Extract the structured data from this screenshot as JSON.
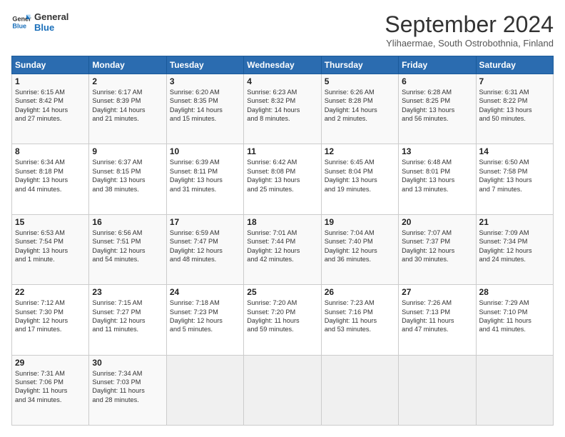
{
  "header": {
    "logo_line1": "General",
    "logo_line2": "Blue",
    "month": "September 2024",
    "location": "Ylihaermae, South Ostrobothnia, Finland"
  },
  "weekdays": [
    "Sunday",
    "Monday",
    "Tuesday",
    "Wednesday",
    "Thursday",
    "Friday",
    "Saturday"
  ],
  "weeks": [
    [
      {
        "day": "1",
        "info": "Sunrise: 6:15 AM\nSunset: 8:42 PM\nDaylight: 14 hours\nand 27 minutes."
      },
      {
        "day": "2",
        "info": "Sunrise: 6:17 AM\nSunset: 8:39 PM\nDaylight: 14 hours\nand 21 minutes."
      },
      {
        "day": "3",
        "info": "Sunrise: 6:20 AM\nSunset: 8:35 PM\nDaylight: 14 hours\nand 15 minutes."
      },
      {
        "day": "4",
        "info": "Sunrise: 6:23 AM\nSunset: 8:32 PM\nDaylight: 14 hours\nand 8 minutes."
      },
      {
        "day": "5",
        "info": "Sunrise: 6:26 AM\nSunset: 8:28 PM\nDaylight: 14 hours\nand 2 minutes."
      },
      {
        "day": "6",
        "info": "Sunrise: 6:28 AM\nSunset: 8:25 PM\nDaylight: 13 hours\nand 56 minutes."
      },
      {
        "day": "7",
        "info": "Sunrise: 6:31 AM\nSunset: 8:22 PM\nDaylight: 13 hours\nand 50 minutes."
      }
    ],
    [
      {
        "day": "8",
        "info": "Sunrise: 6:34 AM\nSunset: 8:18 PM\nDaylight: 13 hours\nand 44 minutes."
      },
      {
        "day": "9",
        "info": "Sunrise: 6:37 AM\nSunset: 8:15 PM\nDaylight: 13 hours\nand 38 minutes."
      },
      {
        "day": "10",
        "info": "Sunrise: 6:39 AM\nSunset: 8:11 PM\nDaylight: 13 hours\nand 31 minutes."
      },
      {
        "day": "11",
        "info": "Sunrise: 6:42 AM\nSunset: 8:08 PM\nDaylight: 13 hours\nand 25 minutes."
      },
      {
        "day": "12",
        "info": "Sunrise: 6:45 AM\nSunset: 8:04 PM\nDaylight: 13 hours\nand 19 minutes."
      },
      {
        "day": "13",
        "info": "Sunrise: 6:48 AM\nSunset: 8:01 PM\nDaylight: 13 hours\nand 13 minutes."
      },
      {
        "day": "14",
        "info": "Sunrise: 6:50 AM\nSunset: 7:58 PM\nDaylight: 13 hours\nand 7 minutes."
      }
    ],
    [
      {
        "day": "15",
        "info": "Sunrise: 6:53 AM\nSunset: 7:54 PM\nDaylight: 13 hours\nand 1 minute."
      },
      {
        "day": "16",
        "info": "Sunrise: 6:56 AM\nSunset: 7:51 PM\nDaylight: 12 hours\nand 54 minutes."
      },
      {
        "day": "17",
        "info": "Sunrise: 6:59 AM\nSunset: 7:47 PM\nDaylight: 12 hours\nand 48 minutes."
      },
      {
        "day": "18",
        "info": "Sunrise: 7:01 AM\nSunset: 7:44 PM\nDaylight: 12 hours\nand 42 minutes."
      },
      {
        "day": "19",
        "info": "Sunrise: 7:04 AM\nSunset: 7:40 PM\nDaylight: 12 hours\nand 36 minutes."
      },
      {
        "day": "20",
        "info": "Sunrise: 7:07 AM\nSunset: 7:37 PM\nDaylight: 12 hours\nand 30 minutes."
      },
      {
        "day": "21",
        "info": "Sunrise: 7:09 AM\nSunset: 7:34 PM\nDaylight: 12 hours\nand 24 minutes."
      }
    ],
    [
      {
        "day": "22",
        "info": "Sunrise: 7:12 AM\nSunset: 7:30 PM\nDaylight: 12 hours\nand 17 minutes."
      },
      {
        "day": "23",
        "info": "Sunrise: 7:15 AM\nSunset: 7:27 PM\nDaylight: 12 hours\nand 11 minutes."
      },
      {
        "day": "24",
        "info": "Sunrise: 7:18 AM\nSunset: 7:23 PM\nDaylight: 12 hours\nand 5 minutes."
      },
      {
        "day": "25",
        "info": "Sunrise: 7:20 AM\nSunset: 7:20 PM\nDaylight: 11 hours\nand 59 minutes."
      },
      {
        "day": "26",
        "info": "Sunrise: 7:23 AM\nSunset: 7:16 PM\nDaylight: 11 hours\nand 53 minutes."
      },
      {
        "day": "27",
        "info": "Sunrise: 7:26 AM\nSunset: 7:13 PM\nDaylight: 11 hours\nand 47 minutes."
      },
      {
        "day": "28",
        "info": "Sunrise: 7:29 AM\nSunset: 7:10 PM\nDaylight: 11 hours\nand 41 minutes."
      }
    ],
    [
      {
        "day": "29",
        "info": "Sunrise: 7:31 AM\nSunset: 7:06 PM\nDaylight: 11 hours\nand 34 minutes."
      },
      {
        "day": "30",
        "info": "Sunrise: 7:34 AM\nSunset: 7:03 PM\nDaylight: 11 hours\nand 28 minutes."
      },
      {
        "day": "",
        "info": ""
      },
      {
        "day": "",
        "info": ""
      },
      {
        "day": "",
        "info": ""
      },
      {
        "day": "",
        "info": ""
      },
      {
        "day": "",
        "info": ""
      }
    ]
  ]
}
